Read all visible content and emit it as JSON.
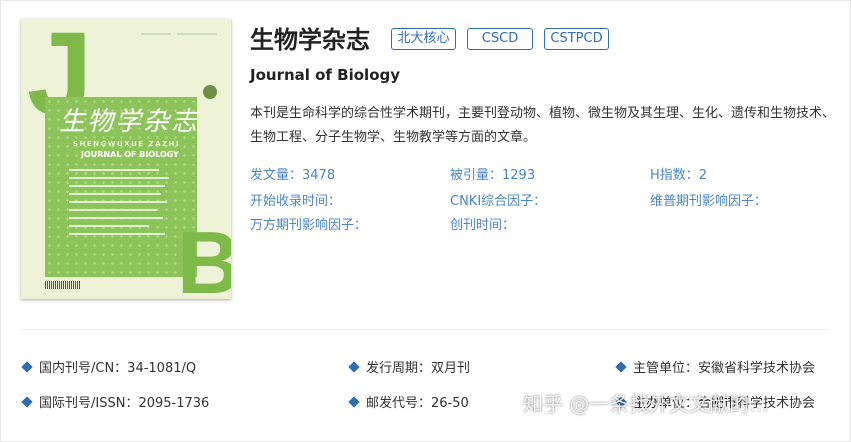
{
  "journal": {
    "name_cn": "生物学杂志",
    "name_en": "Journal of Biology",
    "tags": [
      "北大核心",
      "CSCD",
      "CSTPCD"
    ],
    "description": "本刊是生命科学的综合性学术期刊，主要刊登动物、植物、微生物及其生理、生化、遗传和生物技术、生物工程、分子生物学、生物教学等方面的文章。"
  },
  "cover": {
    "title_art": "生物学杂志",
    "pinyin": "SHENGWUXUE ZAZHI",
    "english": "JOURNAL OF BIOLOGY",
    "letter_top": "J",
    "letter_bottom": "B"
  },
  "stats": {
    "published": "发文量：3478",
    "cited": "被引量：1293",
    "h_index": "H指数：2",
    "start_time": "开始收录时间：",
    "cnki_factor": "CNKI综合因子：",
    "vip_factor": "维普期刊影响因子：",
    "wanfang_factor": "万方期刊影响因子：",
    "founded": "创刊时间："
  },
  "info": {
    "cn": "国内刊号/CN：34-1081/Q",
    "issn": "国际刊号/ISSN：2095-1736",
    "frequency": "发行周期：双月刊",
    "postal": "邮发代号：26-50",
    "supervisor": "主管单位：安徽省科学技术协会",
    "sponsor": "主办单位：合肥市科学技术协会"
  },
  "watermark": "知乎 @一条找外文文献的...",
  "colors": {
    "accent": "#2f6db5",
    "link": "#4a86c5",
    "cover_green": "#8cc35b"
  }
}
